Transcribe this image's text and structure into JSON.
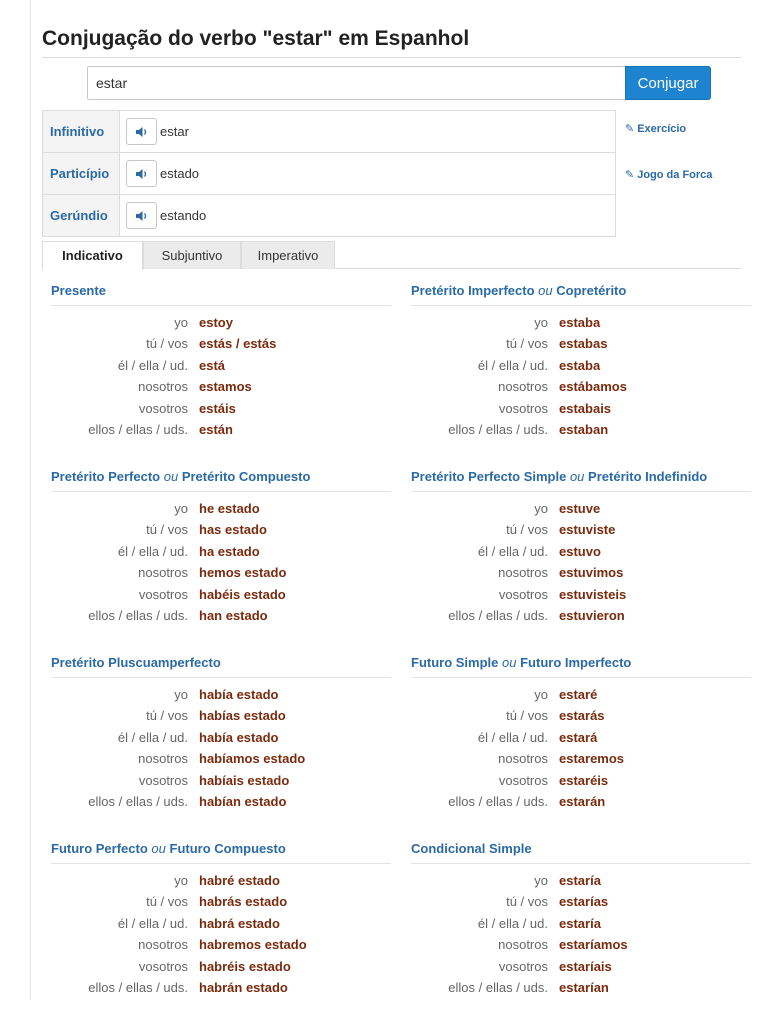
{
  "title": "Conjugação do verbo \"estar\" em Espanhol",
  "search": {
    "value": "estar",
    "button": "Conjugar"
  },
  "forms": [
    {
      "label": "Infinitivo",
      "value": "estar"
    },
    {
      "label": "Particípio",
      "value": "estado"
    },
    {
      "label": "Gerúndio",
      "value": "estando"
    }
  ],
  "links": {
    "exercise": "Exercício",
    "hangman": "Jogo da Forca"
  },
  "tabs": [
    "Indicativo",
    "Subjuntivo",
    "Imperativo"
  ],
  "pronouns": [
    "yo",
    "tú / vos",
    "él / ella / ud.",
    "nosotros",
    "vosotros",
    "ellos / ellas / uds."
  ],
  "tenses": [
    {
      "title": "Presente",
      "alt": "",
      "forms": [
        "estoy",
        "estás / estás",
        "está",
        "estamos",
        "estáis",
        "están"
      ]
    },
    {
      "title": "Pretérito Imperfecto",
      "alt": "Copretérito",
      "forms": [
        "estaba",
        "estabas",
        "estaba",
        "estábamos",
        "estabais",
        "estaban"
      ]
    },
    {
      "title": "Pretérito Perfecto",
      "alt": "Pretérito Compuesto",
      "forms": [
        "he estado",
        "has estado",
        "ha estado",
        "hemos estado",
        "habéis estado",
        "han estado"
      ]
    },
    {
      "title": "Pretérito Perfecto Simple",
      "alt": "Pretérito Indefinido",
      "forms": [
        "estuve",
        "estuviste",
        "estuvo",
        "estuvimos",
        "estuvisteis",
        "estuvieron"
      ]
    },
    {
      "title": "Pretérito Pluscuamperfecto",
      "alt": "",
      "forms": [
        "había estado",
        "habías estado",
        "había estado",
        "habíamos estado",
        "habíais estado",
        "habían estado"
      ]
    },
    {
      "title": "Futuro Simple",
      "alt": "Futuro Imperfecto",
      "forms": [
        "estaré",
        "estarás",
        "estará",
        "estaremos",
        "estaréis",
        "estarán"
      ]
    },
    {
      "title": "Futuro Perfecto",
      "alt": "Futuro Compuesto",
      "forms": [
        "habré estado",
        "habrás estado",
        "habrá estado",
        "habremos estado",
        "habréis estado",
        "habrán estado"
      ]
    },
    {
      "title": "Condicional Simple",
      "alt": "",
      "forms": [
        "estaría",
        "estarías",
        "estaría",
        "estaríamos",
        "estaríais",
        "estarían"
      ]
    }
  ],
  "or_word": "ou",
  "colors": {
    "accent": "#2b6aa5",
    "button": "#1e84cf",
    "verb": "#7a2b0e"
  }
}
